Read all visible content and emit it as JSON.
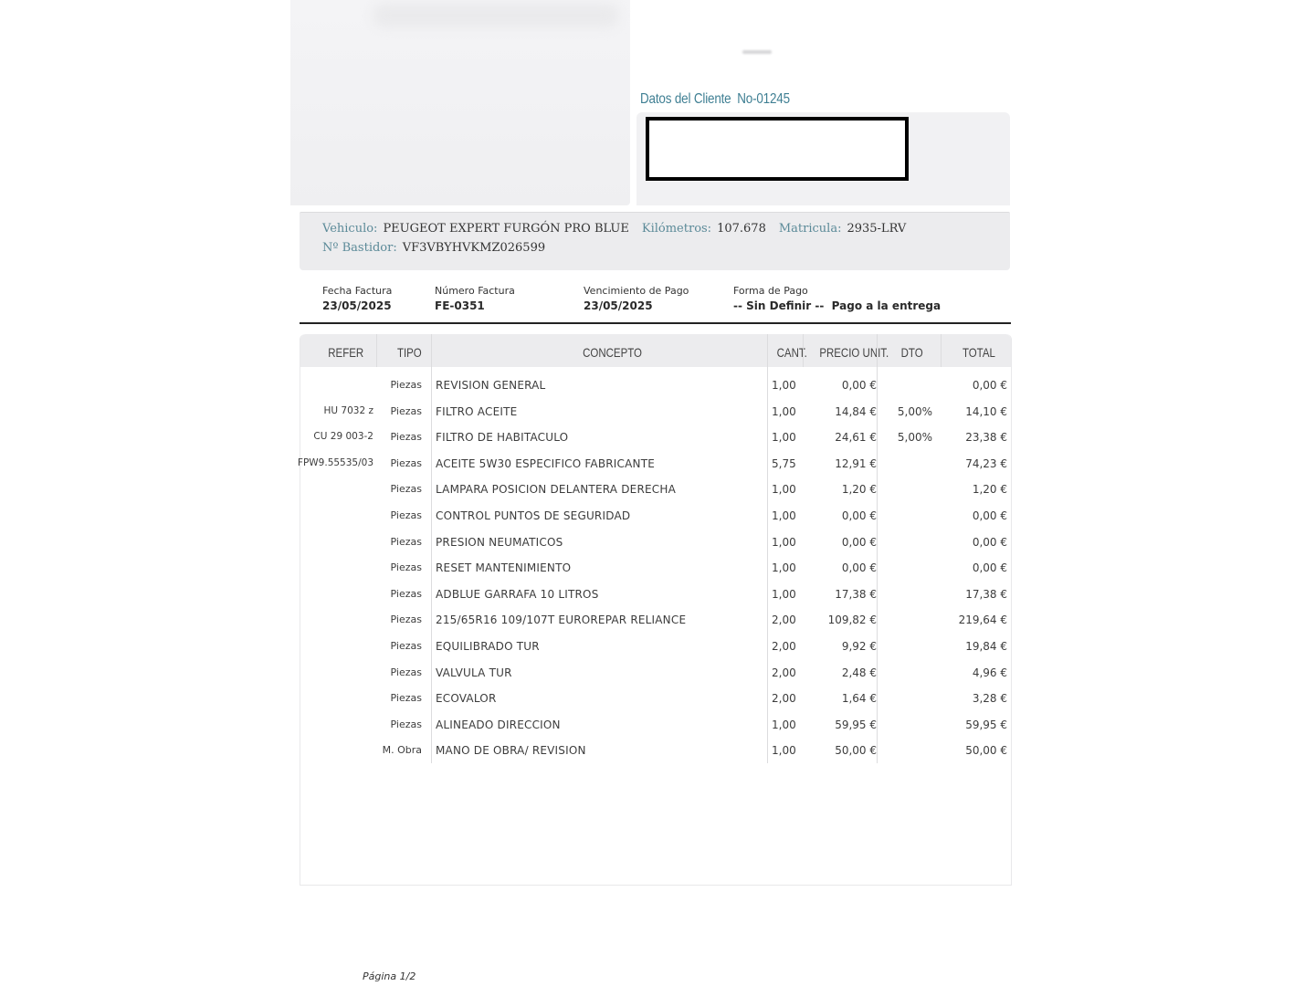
{
  "client": {
    "title": "Datos del Cliente",
    "number": "No-01245"
  },
  "vehicle": {
    "vehiculo_label": "Vehiculo:",
    "vehiculo_value": "PEUGEOT EXPERT FURGÓN PRO BLUE",
    "km_label": "Kilómetros:",
    "km_value": "107.678",
    "matricula_label": "Matricula:",
    "matricula_value": "2935-LRV",
    "bastidor_label": "Nº Bastidor:",
    "bastidor_value": "VF3VBYHVKMZ026599"
  },
  "invoice": {
    "fecha_label": "Fecha Factura",
    "fecha_value": "23/05/2025",
    "numero_label": "Número Factura",
    "numero_value": "FE-0351",
    "venc_label": "Vencimiento de Pago",
    "venc_value": "23/05/2025",
    "forma_label": "Forma de Pago",
    "forma_value": "-- Sin Definir --  Pago a la entrega"
  },
  "table": {
    "headers": {
      "refer": "REFER",
      "tipo": "TIPO",
      "concepto": "CONCEPTO",
      "cant": "CANT.",
      "precio": "PRECIO UNIT.",
      "dto": "DTO",
      "total": "TOTAL"
    },
    "rows": [
      {
        "refer": "",
        "tipo": "Piezas",
        "concepto": "REVISION GENERAL",
        "cant": "1,00",
        "precio": "0,00 €",
        "dto": "",
        "total": "0,00 €"
      },
      {
        "refer": "HU 7032 z",
        "tipo": "Piezas",
        "concepto": "FILTRO ACEITE",
        "cant": "1,00",
        "precio": "14,84 €",
        "dto": "5,00%",
        "total": "14,10 €"
      },
      {
        "refer": "CU 29 003-2",
        "tipo": "Piezas",
        "concepto": "FILTRO DE HABITACULO",
        "cant": "1,00",
        "precio": "24,61 €",
        "dto": "5,00%",
        "total": "23,38 €"
      },
      {
        "refer": "FPW9.55535/03",
        "tipo": "Piezas",
        "concepto": "ACEITE 5W30 ESPECIFICO FABRICANTE",
        "cant": "5,75",
        "precio": "12,91 €",
        "dto": "",
        "total": "74,23 €"
      },
      {
        "refer": "",
        "tipo": "Piezas",
        "concepto": "LAMPARA POSICION DELANTERA DERECHA",
        "cant": "1,00",
        "precio": "1,20 €",
        "dto": "",
        "total": "1,20 €"
      },
      {
        "refer": "",
        "tipo": "Piezas",
        "concepto": "CONTROL PUNTOS DE SEGURIDAD",
        "cant": "1,00",
        "precio": "0,00 €",
        "dto": "",
        "total": "0,00 €"
      },
      {
        "refer": "",
        "tipo": "Piezas",
        "concepto": "PRESION NEUMATICOS",
        "cant": "1,00",
        "precio": "0,00 €",
        "dto": "",
        "total": "0,00 €"
      },
      {
        "refer": "",
        "tipo": "Piezas",
        "concepto": "RESET MANTENIMIENTO",
        "cant": "1,00",
        "precio": "0,00 €",
        "dto": "",
        "total": "0,00 €"
      },
      {
        "refer": "",
        "tipo": "Piezas",
        "concepto": "ADBLUE GARRAFA 10 LITROS",
        "cant": "1,00",
        "precio": "17,38 €",
        "dto": "",
        "total": "17,38 €"
      },
      {
        "refer": "",
        "tipo": "Piezas",
        "concepto": "215/65R16 109/107T EUROREPAR RELIANCE",
        "cant": "2,00",
        "precio": "109,82 €",
        "dto": "",
        "total": "219,64 €"
      },
      {
        "refer": "",
        "tipo": "Piezas",
        "concepto": "EQUILIBRADO TUR",
        "cant": "2,00",
        "precio": "9,92 €",
        "dto": "",
        "total": "19,84 €"
      },
      {
        "refer": "",
        "tipo": "Piezas",
        "concepto": "VALVULA TUR",
        "cant": "2,00",
        "precio": "2,48 €",
        "dto": "",
        "total": "4,96 €"
      },
      {
        "refer": "",
        "tipo": "Piezas",
        "concepto": "ECOVALOR",
        "cant": "2,00",
        "precio": "1,64 €",
        "dto": "",
        "total": "3,28 €"
      },
      {
        "refer": "",
        "tipo": "Piezas",
        "concepto": "ALINEADO DIRECCION",
        "cant": "1,00",
        "precio": "59,95 €",
        "dto": "",
        "total": "59,95 €"
      },
      {
        "refer": "",
        "tipo": "M. Obra",
        "concepto": "MANO DE OBRA/ REVISION",
        "cant": "1,00",
        "precio": "50,00 €",
        "dto": "",
        "total": "50,00 €"
      }
    ]
  },
  "footer": {
    "page": "Página 1/2"
  }
}
